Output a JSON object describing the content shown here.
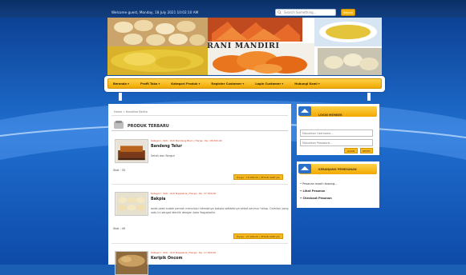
{
  "header": {
    "welcome": "Welcome guest, Monday, 18 July 2021 10:02:10 AM",
    "search_placeholder": "Search Something...",
    "search_button": "Search"
  },
  "banner": {
    "brand": "RANI MANDIRI"
  },
  "nav": {
    "items": [
      "Beranda ▾",
      "Profil Toko ▾",
      "Kategori Produk ▾",
      "Register Customer ▾",
      "Login Customer ▾",
      "Hubungi Kami ▾"
    ]
  },
  "breadcrumb": "Home »  Headline Berita",
  "section_title": "PRODUK TERBARU",
  "products": [
    {
      "category": "Kategori : Roti - Roti Bandeng Bisin | Harga : Rp. 18.000,00",
      "name": "Bandeng Telur",
      "desc": "Sehat dan Bergizi",
      "stock": "Stok : 33",
      "price_btn": "Harga : 18.000,00 | PESAN SKRT JAL"
    },
    {
      "category": "Kategori : Roti - Roti Bagelaria | Harga : Rp. 27.000,00",
      "name": "Bakpia",
      "desc": "anda pasti sudah pernah mencicipi nikmatnya bakpia setidaknya sekali seumur hidup. Camilan yang satu ini sangat identik dengan kota Yogyakarta.",
      "stock": "Stok : 49",
      "price_btn": "Harga : 27.000,00 | PESAN SKRT JAL"
    },
    {
      "category": "Kategori : Roti - Roti Bagelaria | Harga : Rp. 17.000,00",
      "name": "Keripik Oncom"
    }
  ],
  "login_widget": {
    "title": "LOGIN MEMBER",
    "username_placeholder": "Masukkan Username...",
    "password_placeholder": "Masukkan Password...",
    "login_button": "LOGIN",
    "reset_button": "RESET"
  },
  "cart_widget": {
    "title": "KERANJANG PEMESANAN",
    "items": [
      "•  Pesanan masih kosong...",
      "•  Lihat Pesanan",
      "•  Checkout Pesanan"
    ]
  },
  "colors": {
    "background": "#1a5fb4",
    "accent": "#f2b40f",
    "topbar": "#0b2f66"
  }
}
